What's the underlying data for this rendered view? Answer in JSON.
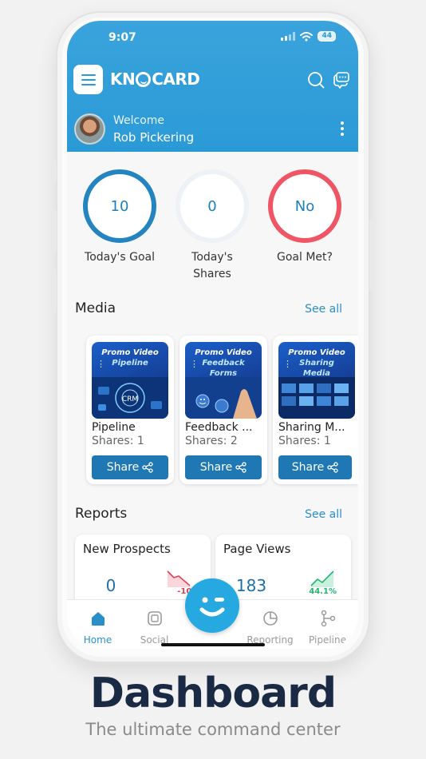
{
  "status_bar": {
    "time": "9:07",
    "battery": "44"
  },
  "header": {
    "logo_text_left": "KN",
    "logo_text_right": "CARD",
    "welcome_label": "Welcome",
    "user_name": "Rob Pickering"
  },
  "stats": [
    {
      "value": "10",
      "label": "Today's Goal",
      "ring_color": "#2384c0"
    },
    {
      "value": "0",
      "label": "Today's Shares",
      "ring_color": "#eef1f5"
    },
    {
      "value": "No",
      "label": "Goal Met?",
      "ring_color": "#f05566"
    }
  ],
  "media": {
    "title": "Media",
    "see_all": "See all",
    "items": [
      {
        "thumb_line1": "Promo Video",
        "thumb_line2": "Pipeline",
        "thumb_line3": "",
        "title": "Pipeline",
        "shares": "Shares: 1",
        "share_label": "Share"
      },
      {
        "thumb_line1": "Promo Video",
        "thumb_line2": "Feedback",
        "thumb_line3": "Forms",
        "title": "Feedback ...",
        "shares": "Shares: 2",
        "share_label": "Share"
      },
      {
        "thumb_line1": "Promo Video",
        "thumb_line2": "Sharing",
        "thumb_line3": "Media",
        "title": "Sharing M...",
        "shares": "Shares: 1",
        "share_label": "Share"
      }
    ]
  },
  "reports": {
    "title": "Reports",
    "see_all": "See all",
    "items": [
      {
        "title": "New Prospects",
        "value": "0",
        "change": "-100.0",
        "trend": "down",
        "color": "#e0404f"
      },
      {
        "title": "Page Views",
        "value": "183",
        "change": "44.1%",
        "trend": "up",
        "color": "#22b573"
      }
    ]
  },
  "tabbar": {
    "items": [
      {
        "label": "Home",
        "icon": "home-icon",
        "active": true
      },
      {
        "label": "Social",
        "icon": "social-icon",
        "active": false
      },
      {
        "label": "Reporting",
        "icon": "reporting-icon",
        "active": false
      },
      {
        "label": "Pipeline",
        "icon": "pipeline-icon",
        "active": false
      }
    ]
  },
  "promo": {
    "title": "Dashboard",
    "subtitle": "The ultimate command center"
  }
}
